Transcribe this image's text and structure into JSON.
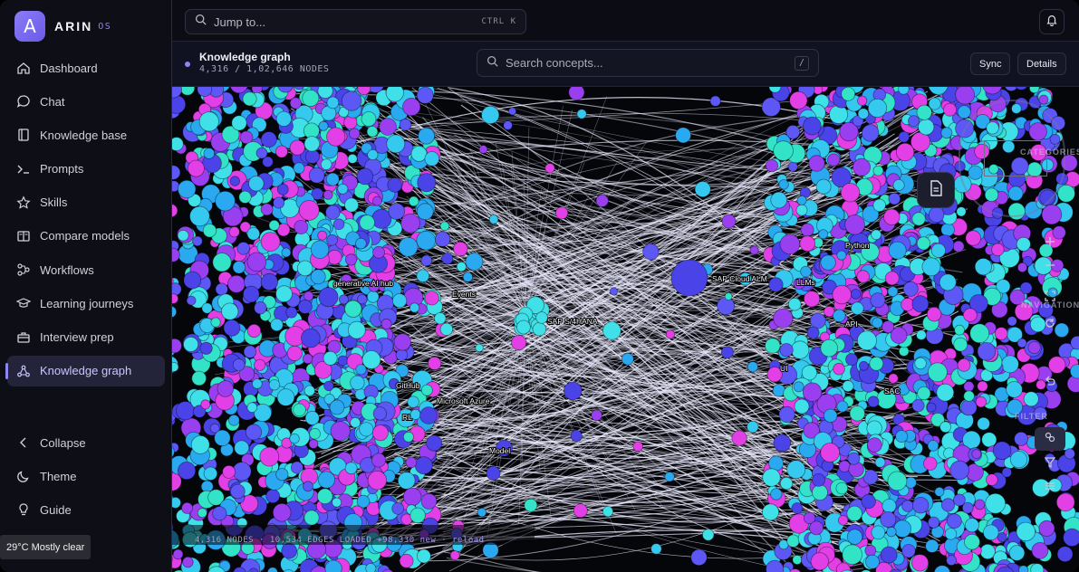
{
  "brand": {
    "logo": "A",
    "name": "ARIN",
    "suffix": "OS"
  },
  "nav": [
    {
      "label": "Dashboard",
      "icon": "home-icon"
    },
    {
      "label": "Chat",
      "icon": "chat-icon"
    },
    {
      "label": "Knowledge base",
      "icon": "book-icon"
    },
    {
      "label": "Prompts",
      "icon": "terminal-icon"
    },
    {
      "label": "Skills",
      "icon": "star-icon"
    },
    {
      "label": "Compare models",
      "icon": "compare-icon"
    },
    {
      "label": "Workflows",
      "icon": "workflow-icon"
    },
    {
      "label": "Learning journeys",
      "icon": "graduation-icon"
    },
    {
      "label": "Interview prep",
      "icon": "briefcase-icon"
    },
    {
      "label": "Knowledge graph",
      "icon": "graph-icon",
      "active": true
    }
  ],
  "nav_bottom": [
    {
      "label": "Collapse",
      "icon": "chevron-left-icon"
    },
    {
      "label": "Theme",
      "icon": "moon-icon"
    },
    {
      "label": "Guide",
      "icon": "lightbulb-icon"
    }
  ],
  "weather": {
    "text": "29°C Mostly clear"
  },
  "topbar": {
    "jump_label": "Jump to...",
    "shortcut": "CTRL K"
  },
  "header": {
    "title": "Knowledge graph",
    "count": "4,316 / 1,02,646 NODES",
    "search_placeholder": "Search concepts...",
    "search_shortcut": "/",
    "sync_label": "Sync",
    "details_label": "Details"
  },
  "status": {
    "loaded": "4,316 NODES · 10,534 EDGES LOADED",
    "new": "+98,330 new · reload"
  },
  "graph": {
    "colors": [
      "#3fe0e8",
      "#36c9f0",
      "#e23fe6",
      "#4a44e8",
      "#2aa8f0",
      "#33e3c8",
      "#9a3ff0",
      "#5d57f6"
    ],
    "labels": [
      "generative AI hub",
      "Events",
      "SAP S/4HANA",
      "SAP Cloud ALM",
      "LLMs",
      "Python",
      "API",
      "GitHub",
      "Microsoft Azure",
      "RL",
      "Model",
      "SAC",
      "UI"
    ],
    "side_text": [
      "CATEGORIES",
      "NAVIGATION",
      "FILTER"
    ]
  }
}
